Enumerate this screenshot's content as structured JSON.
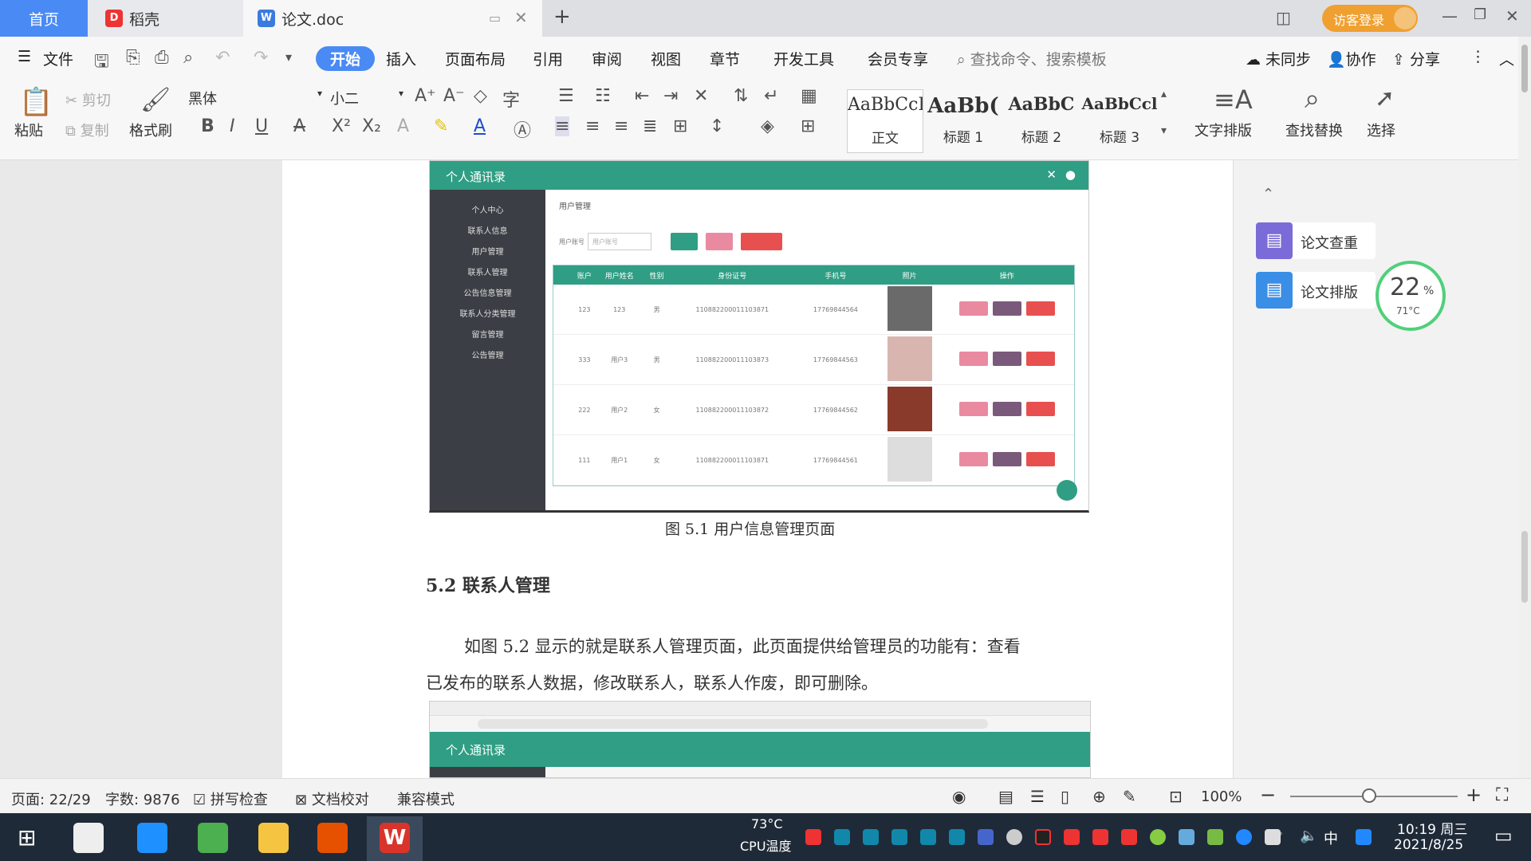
{
  "tabs": {
    "home": "首页",
    "daoke": "稻壳",
    "doc": "论文.doc"
  },
  "titlebar": {
    "guest_login": "访客登录"
  },
  "menu": {
    "file": "文件",
    "start": "开始",
    "insert": "插入",
    "layout": "页面布局",
    "reference": "引用",
    "review": "审阅",
    "view": "视图",
    "chapter": "章节",
    "devtools": "开发工具",
    "member": "会员专享",
    "search_placeholder": "查找命令、搜索模板",
    "unsynced": "未同步",
    "collab": "协作",
    "share": "分享"
  },
  "toolbar": {
    "paste": "粘贴",
    "cut": "剪切",
    "copy": "复制",
    "format_painter": "格式刷",
    "font": "黑体",
    "size": "小二",
    "styles": [
      {
        "preview": "AaBbCcI",
        "name": "正文"
      },
      {
        "preview": "AaBb(",
        "name": "标题 1"
      },
      {
        "preview": "AaBbC",
        "name": "标题 2"
      },
      {
        "preview": "AaBbCcl",
        "name": "标题 3"
      }
    ],
    "text_layout": "文字排版",
    "find_replace": "查找替换",
    "select": "选择"
  },
  "document": {
    "fig_caption": "图 5.1  用户信息管理页面",
    "heading": "5.2  联系人管理",
    "para1": "如图 5.2 显示的就是联系人管理页面，此页面提供给管理员的功能有：查看",
    "para2": "已发布的联系人数据，修改联系人，联系人作废，即可删除。",
    "shot1": {
      "app_title": "个人通讯录",
      "side_items": [
        "个人中心",
        "联系人信息",
        "用户管理",
        "联系人管理",
        "公告信息管理",
        "联系人分类管理",
        "留言管理",
        "公告管理"
      ],
      "page_title": "用户管理",
      "search_label": "用户账号",
      "search_placeholder": "用户账号",
      "table_headers": [
        "",
        "账户",
        "用户姓名",
        "性别",
        "身份证号",
        "手机号",
        "照片",
        "操作"
      ],
      "rows": [
        {
          "acct": "123",
          "name": "123",
          "sex": "男",
          "id": "110882200011103871",
          "phone": "17769844564"
        },
        {
          "acct": "333",
          "name": "用户3",
          "sex": "男",
          "id": "110882200011103873",
          "phone": "17769844563"
        },
        {
          "acct": "222",
          "name": "用户2",
          "sex": "女",
          "id": "110882200011103872",
          "phone": "17769844562"
        },
        {
          "acct": "111",
          "name": "用户1",
          "sex": "女",
          "id": "110882200011103871",
          "phone": "17769844561"
        }
      ]
    },
    "shot2": {
      "app_title": "个人通讯录"
    }
  },
  "rpanel": {
    "check": "论文查重",
    "typeset": "论文排版",
    "cpu_percent": "22",
    "cpu_unit": "%",
    "temp": "71°C"
  },
  "status": {
    "page": "页面: 22/29",
    "words": "字数: 9876",
    "spell": "拼写检查",
    "proof": "文档校对",
    "compat": "兼容模式",
    "zoom": "100%"
  },
  "taskbar": {
    "cpu_temp_value": "73°C",
    "cpu_temp_label": "CPU温度",
    "ime": "中",
    "time": "10:19 周三",
    "date": "2021/8/25"
  },
  "colors": {
    "accent": "#4a8af4",
    "teal": "#2f9e84",
    "sidebar": "#3b3f45",
    "wps_red": "#d9342b"
  }
}
